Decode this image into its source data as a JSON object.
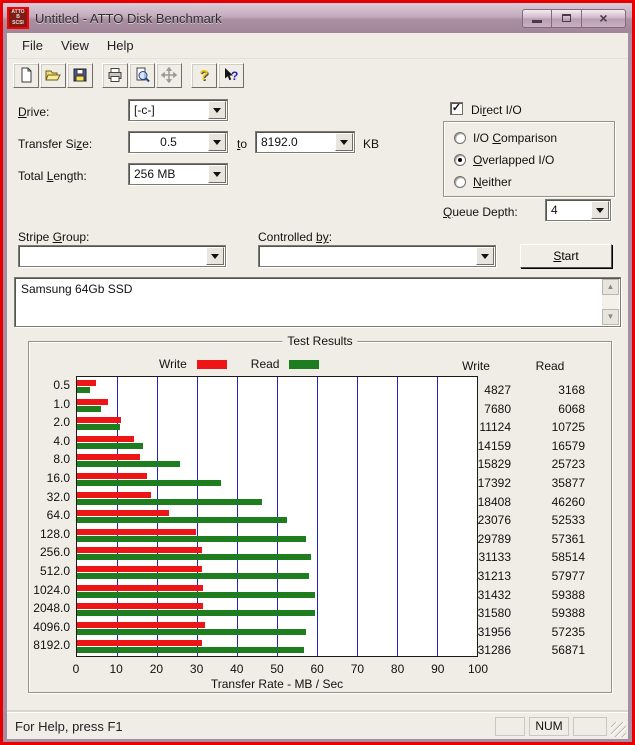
{
  "window": {
    "title": "Untitled - ATTO Disk Benchmark",
    "icon_lines": [
      "ATTO",
      "B",
      "SCSI"
    ],
    "close_glyph": "×"
  },
  "menu": {
    "items": [
      "File",
      "View",
      "Help"
    ]
  },
  "toolbar": {
    "items": [
      "new-document",
      "open-file",
      "save-file",
      "print",
      "print-preview",
      "move",
      "help",
      "context-help"
    ]
  },
  "form": {
    "drive": {
      "label": "Drive:",
      "value": "[-c-]"
    },
    "transfer_size": {
      "label": "Transfer Size:",
      "from": "0.5",
      "joiner": "to",
      "to": "8192.0",
      "unit": "KB"
    },
    "total_length": {
      "label": "Total Length:",
      "value": "256 MB"
    },
    "direct_io": {
      "label": "Direct I/O",
      "checked": true,
      "check_glyph": "✓"
    },
    "io_mode": {
      "options": [
        {
          "label": "I/O Comparison",
          "accel": "4"
        },
        {
          "label": "Overlapped I/O",
          "accel": "0"
        },
        {
          "label": "Neither",
          "accel": "0"
        }
      ],
      "selected": "Overlapped I/O"
    },
    "queue_depth": {
      "label": "Queue Depth:",
      "value": "4"
    },
    "stripe_group": {
      "label": "Stripe Group:",
      "value": ""
    },
    "controlled_by": {
      "label": "Controlled by:",
      "value": ""
    },
    "start_label": "Start",
    "description": "Samsung 64Gb SSD"
  },
  "results": {
    "group_title": "Test Results",
    "legend_write": "Write",
    "legend_read": "Read",
    "col_write": "Write",
    "col_read": "Read",
    "write_color": "#ed1515",
    "read_color": "#1e7d1e"
  },
  "chart_data": {
    "type": "bar",
    "orientation": "horizontal",
    "title": "Test Results",
    "xlabel": "Transfer Rate - MB / Sec",
    "xlim": [
      0,
      100
    ],
    "x_ticks": [
      0,
      10,
      20,
      30,
      40,
      50,
      60,
      70,
      80,
      90,
      100
    ],
    "grid": true,
    "grid_color": "#2323b5",
    "categories": [
      "0.5",
      "1.0",
      "2.0",
      "4.0",
      "8.0",
      "16.0",
      "32.0",
      "64.0",
      "128.0",
      "256.0",
      "512.0",
      "1024.0",
      "2048.0",
      "4096.0",
      "8192.0"
    ],
    "value_unit": "KB/Sec (bars plotted as MB/Sec = value/1000)",
    "series": [
      {
        "name": "Write",
        "color": "#ed1515",
        "values": [
          4827,
          7680,
          11124,
          14159,
          15829,
          17392,
          18408,
          23076,
          29789,
          31133,
          31213,
          31432,
          31580,
          31956,
          31286
        ]
      },
      {
        "name": "Read",
        "color": "#1e7d1e",
        "values": [
          3168,
          6068,
          10725,
          16579,
          25723,
          35877,
          46260,
          52533,
          57361,
          58514,
          57977,
          59388,
          59388,
          57235,
          56871
        ]
      }
    ],
    "legend_position": "top"
  },
  "status": {
    "message": "For Help, press F1",
    "num": "NUM"
  }
}
